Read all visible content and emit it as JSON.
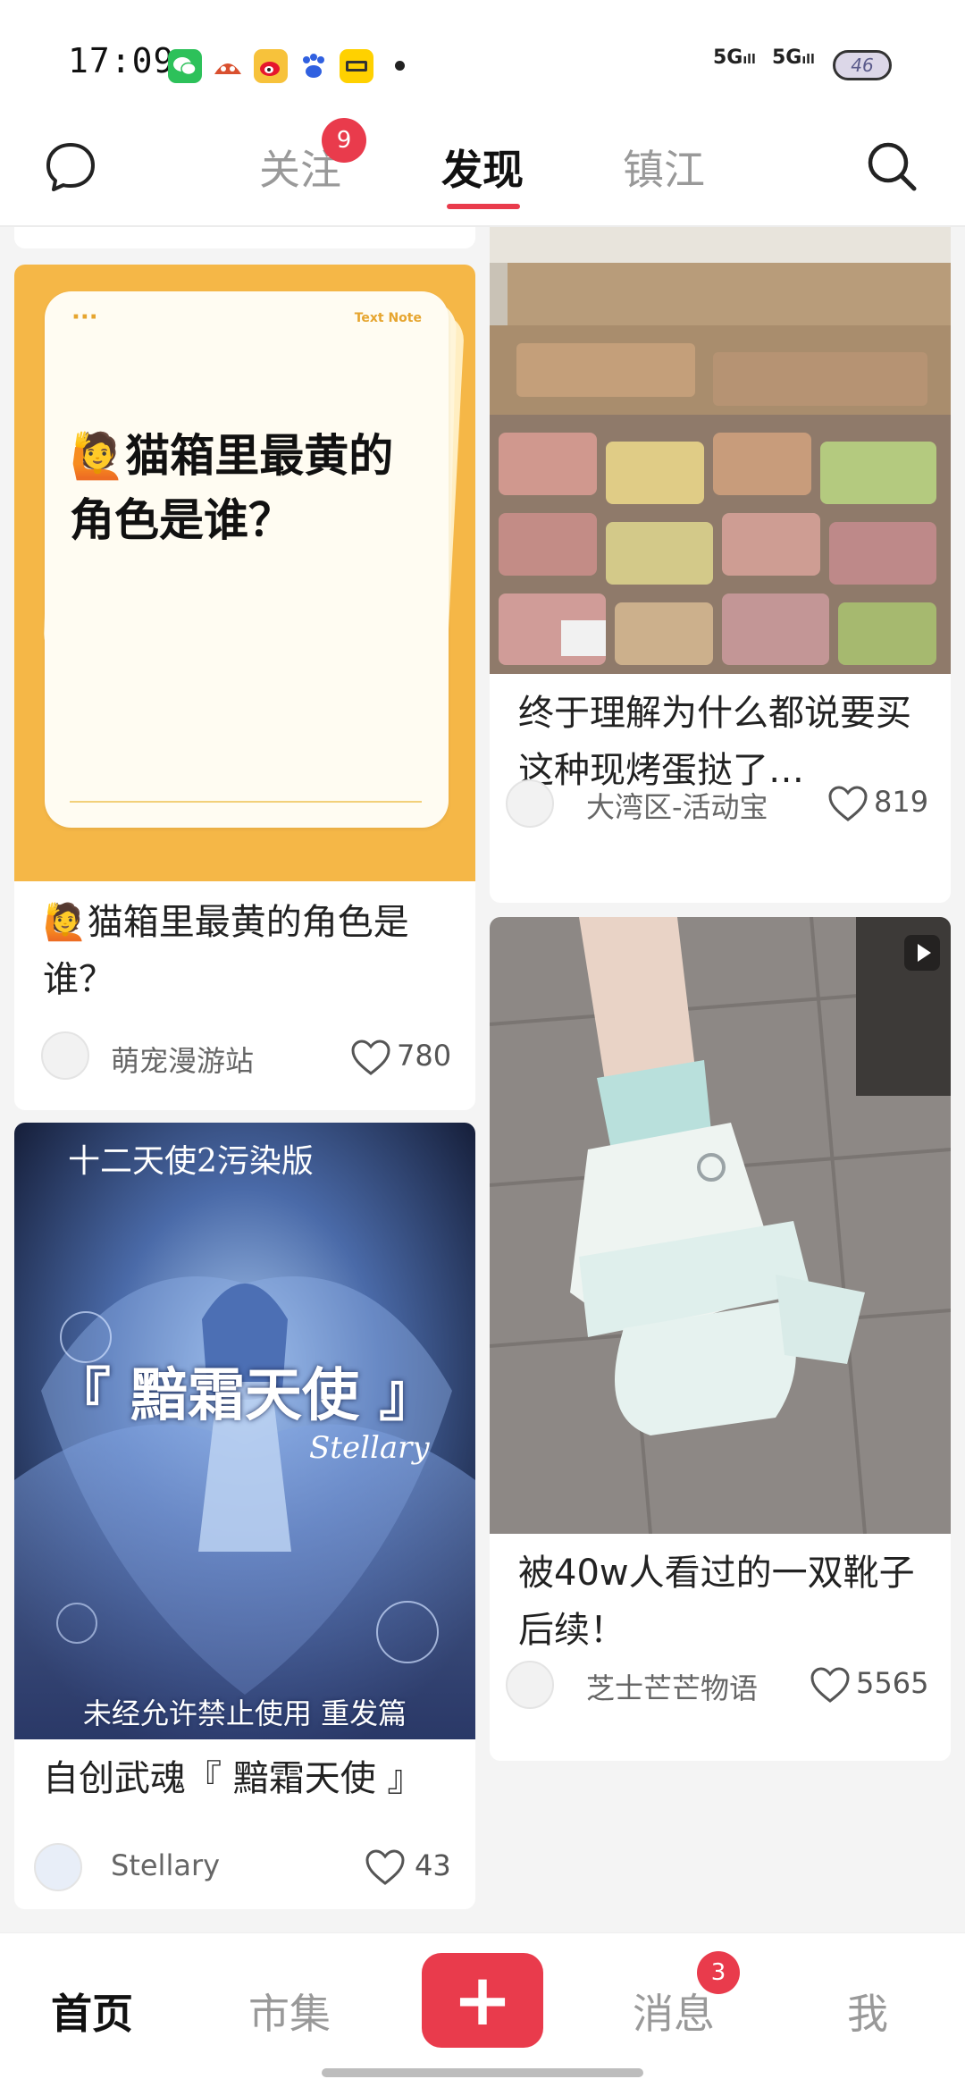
{
  "status_bar": {
    "time": "17:09",
    "signal_1": "5G",
    "signal_2": "5G",
    "battery": "46"
  },
  "header": {
    "tabs": [
      {
        "label": "关注"
      },
      {
        "label": "发现"
      },
      {
        "label": "镇江"
      }
    ],
    "follow_badge": "9",
    "active_tab": "发现"
  },
  "feed": {
    "left": [
      {
        "note_card": {
          "dots": "···",
          "tag": "Text Note",
          "text": "🙋猫箱里最黄的角色是谁？"
        },
        "title": "🙋猫箱里最黄的角色是谁？",
        "author": "萌宠漫游站",
        "likes": "780"
      },
      {
        "image": {
          "header_text": "十二天使2污染版",
          "big_title": "『 黯霜天使 』",
          "signature": "Stellary",
          "footer_text": "未经允许禁止使用 重发篇"
        },
        "title": "自创武魂『 黯霜天使 』",
        "author": "Stellary",
        "likes": "43"
      }
    ],
    "right": [
      {
        "title": "终于理解为什么都说要买这种现烤蛋挞了…",
        "author": "大湾区-活动宝",
        "likes": "819"
      },
      {
        "title": "被40w人看过的一双靴子后续！",
        "author": "芝士芒芒物语",
        "likes": "5565"
      }
    ]
  },
  "bottom_nav": {
    "home": "首页",
    "market": "市集",
    "add": "+",
    "messages": "消息",
    "messages_badge": "3",
    "me": "我"
  },
  "colors": {
    "accent": "#e93b4c",
    "note_bg": "#f5b747"
  }
}
